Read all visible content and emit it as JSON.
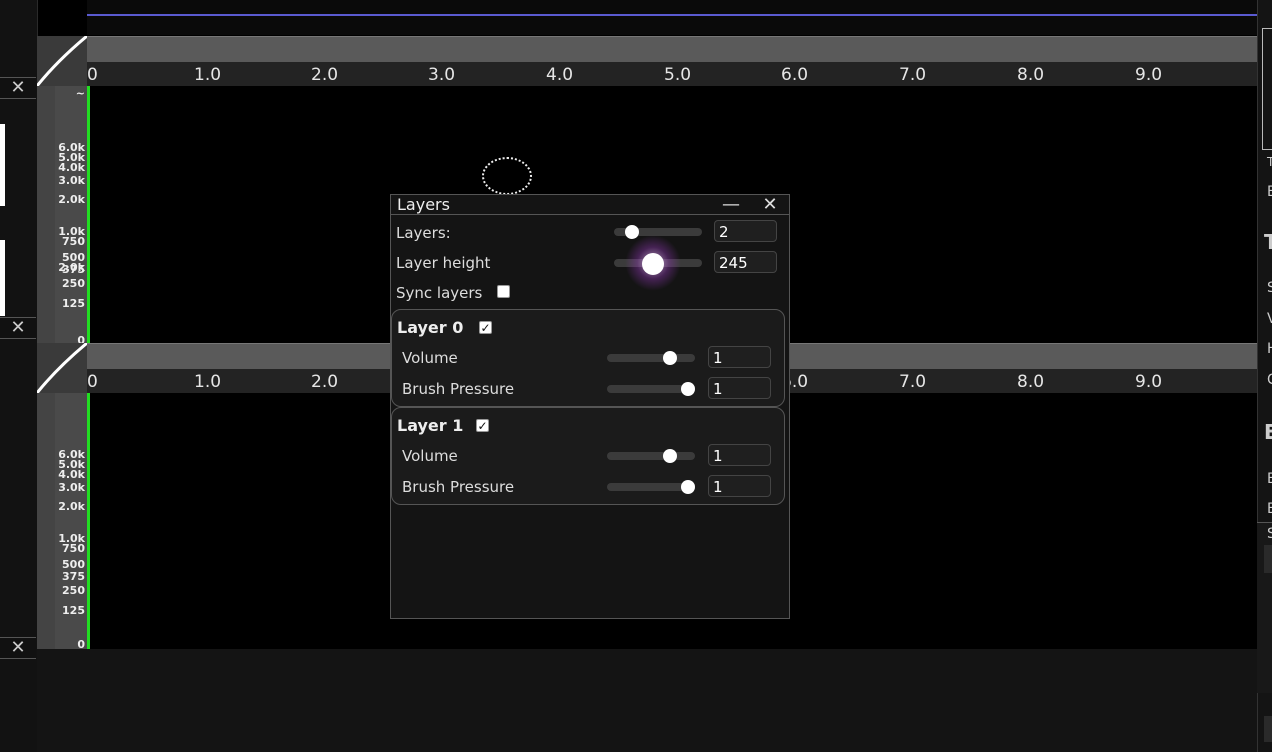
{
  "time_ruler": {
    "ticks": [
      "0",
      "1.0",
      "2.0",
      "3.0",
      "4.0",
      "5.0",
      "6.0",
      "7.0",
      "8.0",
      "9.0"
    ]
  },
  "freq_axis": {
    "labels": [
      "2.0k",
      "3.0k",
      "4.0k",
      "5.0k",
      "6.0k",
      "1.0k",
      "750",
      "500",
      "375",
      "250",
      "125",
      "0"
    ]
  },
  "sidebar": {
    "close_glyph": "✕"
  },
  "layers_panel": {
    "title": "Layers",
    "minimize_glyph": "—",
    "close_glyph": "✕",
    "layers_label": "Layers:",
    "layers_value": "2",
    "layers_slider_level": 0.15,
    "layer_height_label": "Layer height",
    "layer_height_value": "245",
    "layer_height_slider_level": 0.42,
    "sync_label": "Sync layers",
    "sync_checked": false,
    "layers": [
      {
        "name": "Layer 0",
        "enabled": true,
        "volume_label": "Volume",
        "volume_value": "1",
        "volume_level": 0.75,
        "pressure_label": "Brush Pressure",
        "pressure_value": "1",
        "pressure_level": 1.0
      },
      {
        "name": "Layer 1",
        "enabled": true,
        "volume_label": "Volume",
        "volume_value": "1",
        "volume_level": 0.75,
        "pressure_label": "Brush Pressure",
        "pressure_value": "1",
        "pressure_level": 1.0
      }
    ],
    "check_glyph": "✓"
  },
  "right_panel": {
    "letters": [
      "T",
      "E",
      "T",
      "S",
      "V",
      "H",
      "C",
      "E",
      "E",
      "E",
      "S"
    ]
  },
  "colors": {
    "accent_green": "#22dd22",
    "timeline_line": "#5a5ad0",
    "panel_bg": "#141414"
  }
}
